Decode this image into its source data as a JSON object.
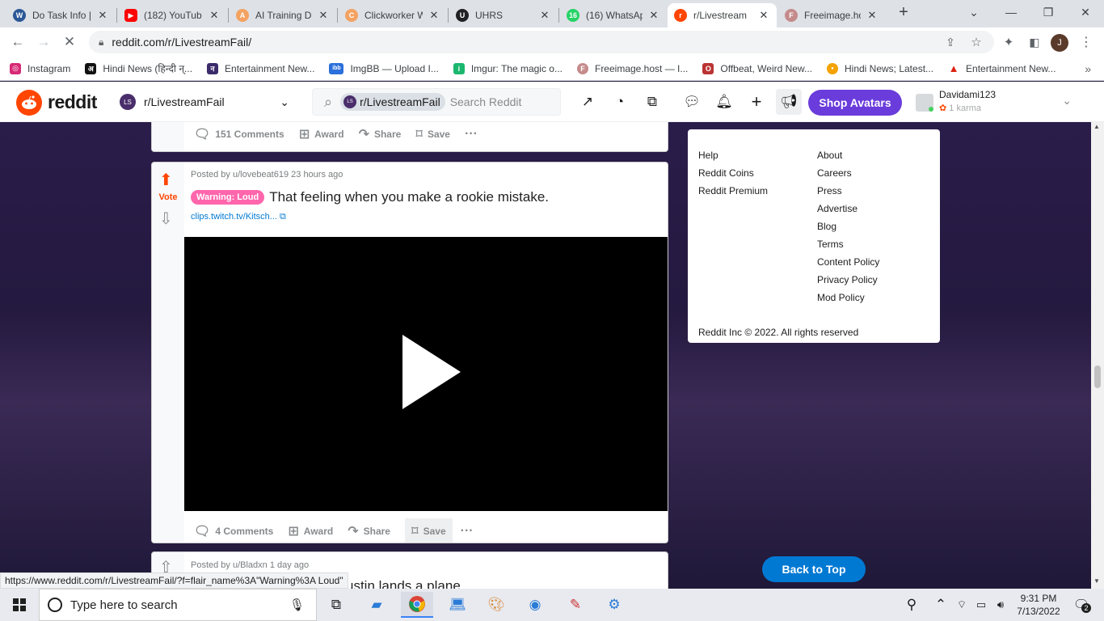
{
  "browser": {
    "tabs": [
      {
        "title": "Do Task Info |",
        "icon_color": "#2b5797",
        "icon_text": "W"
      },
      {
        "title": "(182) YouTub",
        "icon_color": "#ff0000",
        "icon_text": "▶"
      },
      {
        "title": "AI Training Da",
        "icon_color": "#f4a261",
        "icon_text": "A"
      },
      {
        "title": "Clickworker W",
        "icon_color": "#f4a261",
        "icon_text": "C"
      },
      {
        "title": "UHRS",
        "icon_color": "#202124",
        "icon_text": "U"
      },
      {
        "title": "(16) WhatsAp",
        "icon_color": "#25d366",
        "icon_text": "16"
      },
      {
        "title": "r/Livestream",
        "icon_color": "#ff4500",
        "icon_text": "r"
      },
      {
        "title": "Freeimage.ho",
        "icon_color": "#c58b8b",
        "icon_text": "F"
      }
    ],
    "new_tab": "+",
    "url": "reddit.com/r/LivestreamFail/",
    "profile_initial": "J",
    "bookmarks": [
      {
        "label": "Instagram",
        "color": "#d62976",
        "text": "◎"
      },
      {
        "label": "Hindi News (हिन्दी न्...",
        "color": "#111111",
        "text": "अ"
      },
      {
        "label": "Entertainment New...",
        "color": "#3b2b6b",
        "text": "न"
      },
      {
        "label": "ImgBB — Upload I...",
        "color": "#2a6fdb",
        "text": "ibb"
      },
      {
        "label": "Imgur: The magic o...",
        "color": "#1bb76e",
        "text": "i"
      },
      {
        "label": "Freeimage.host — I...",
        "color": "#c58b8b",
        "text": "F"
      },
      {
        "label": "Offbeat, Weird New...",
        "color": "#b33",
        "text": "O"
      },
      {
        "label": "Hindi News; Latest...",
        "color": "#f4a300",
        "text": "●"
      },
      {
        "label": "Entertainment New...",
        "color": "#d21",
        "text": "▲"
      }
    ],
    "status_url": "https://www.reddit.com/r/LivestreamFail/?f=flair_name%3A\"Warning%3A Loud\""
  },
  "reddit": {
    "logo_text": "reddit",
    "community": "r/LivestreamFail",
    "community_icon": "LS",
    "search_chip": "r/LivestreamFail",
    "search_placeholder": "Search Reddit",
    "shop_avatars": "Shop Avatars",
    "username": "Davidami123",
    "karma": "1 karma"
  },
  "posts": [
    {
      "comments": "151 Comments",
      "award": "Award",
      "share": "Share",
      "save": "Save"
    },
    {
      "vote_label": "Vote",
      "meta": "Posted by u/lovebeat619 23 hours ago",
      "flair": "Warning: Loud",
      "title": "That feeling when you make a rookie mistake.",
      "link": "clips.twitch.tv/Kitsch...",
      "comments": "4 Comments",
      "award": "Award",
      "share": "Share",
      "save": "Save"
    },
    {
      "meta": "Posted by u/Bladxn 1 day ago",
      "title_fragment": "ustin lands a plane"
    }
  ],
  "sidebar": {
    "left_links": [
      "Help",
      "Reddit Coins",
      "Reddit Premium"
    ],
    "right_links": [
      "About",
      "Careers",
      "Press",
      "Advertise",
      "Blog",
      "Terms",
      "Content Policy",
      "Privacy Policy",
      "Mod Policy"
    ],
    "copyright": "Reddit Inc © 2022. All rights reserved"
  },
  "back_to_top": "Back to Top",
  "taskbar": {
    "search_placeholder": "Type here to search",
    "time": "9:31 PM",
    "date": "7/13/2022",
    "notifications": "2"
  },
  "colors": {
    "reddit_orange": "#ff4500",
    "shop_avatars_bg": "#6a3cdb",
    "back_to_top_bg": "#0079d3",
    "flair_bg": "#ff66ac"
  }
}
